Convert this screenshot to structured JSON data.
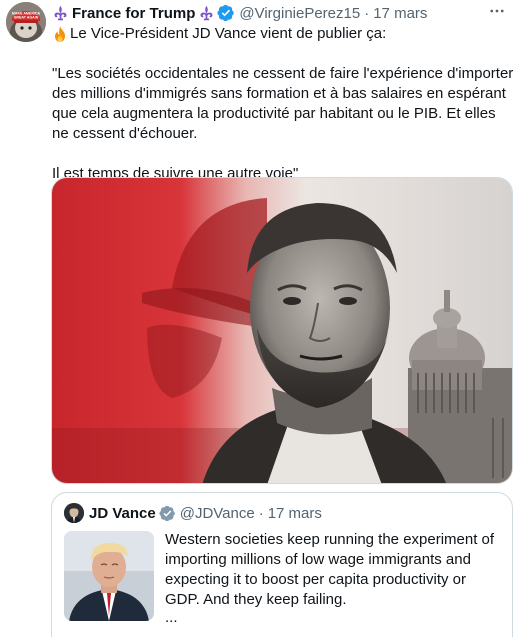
{
  "tweet": {
    "author": {
      "display_name": "France for Trump",
      "handle": "@VirginiePerez15",
      "avatar_text": "MAKE AMERICA GREAT AGAIN TRUMP",
      "verified": true
    },
    "separator": "·",
    "date": "17 mars",
    "intro": "Le Vice-Président JD Vance vient de publier ça:",
    "quote_paragraph_1": "\"Les sociétés occidentales ne cessent de faire l'expérience d'importer des millions d'immigrés sans formation et à bas salaires en espérant que cela augmentera la productivité par habitant ou le PIB. Et elles ne cessent d'échouer.",
    "quote_paragraph_2": "Il est temps de suivre une autre voie\"",
    "icons": {
      "fleur": "fleur-de-lis-icon",
      "verified": "verified-badge-icon",
      "more": "more-options-icon",
      "fire": "fire-emoji-icon"
    }
  },
  "quoted_tweet": {
    "display_name": "JD Vance",
    "handle": "@JDVance",
    "separator": "·",
    "date": "17 mars",
    "text": "Western societies keep running the experiment of importing millions of low wage immigrants and expecting it to boost per capita productivity or GDP. And they keep failing.",
    "ellipsis": "...",
    "verified": true
  },
  "colors": {
    "accent_blue": "#1d9bf0",
    "secondary_text": "#536471",
    "primary_text": "#0f1419",
    "media_red": "#c7262c"
  }
}
